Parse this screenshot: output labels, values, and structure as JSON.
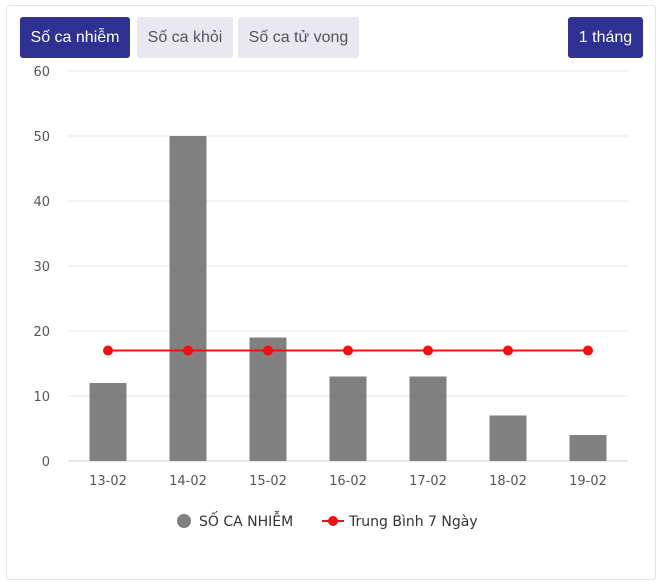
{
  "tabs": [
    {
      "label": "Số ca nhiễm",
      "active": true
    },
    {
      "label": "Số ca khỏi",
      "active": false
    },
    {
      "label": "Số ca tử vong",
      "active": false
    }
  ],
  "range_button": {
    "label": "1 tháng"
  },
  "colors": {
    "accent": "#2e3192",
    "bar": "#808080",
    "line": "#ee1111",
    "tab_inactive": "#e8e8f0"
  },
  "legend": [
    {
      "label": "SỐ CA NHIỄM",
      "marker": "circle",
      "color": "#808080"
    },
    {
      "label": "Trung Bình 7 Ngày",
      "marker": "line-circle",
      "color": "#ee1111"
    }
  ],
  "chart_data": {
    "type": "bar",
    "categories": [
      "13-02",
      "14-02",
      "15-02",
      "16-02",
      "17-02",
      "18-02",
      "19-02"
    ],
    "series": [
      {
        "name": "SỐ CA NHIỄM",
        "type": "bar",
        "values": [
          12,
          50,
          19,
          13,
          13,
          7,
          4
        ]
      },
      {
        "name": "Trung Bình 7 Ngày",
        "type": "line",
        "values": [
          17,
          17,
          17,
          17,
          17,
          17,
          17
        ]
      }
    ],
    "ylim": [
      0,
      60
    ],
    "yticks": [
      0,
      10,
      20,
      30,
      40,
      50,
      60
    ],
    "grid": true,
    "legend_position": "bottom"
  }
}
